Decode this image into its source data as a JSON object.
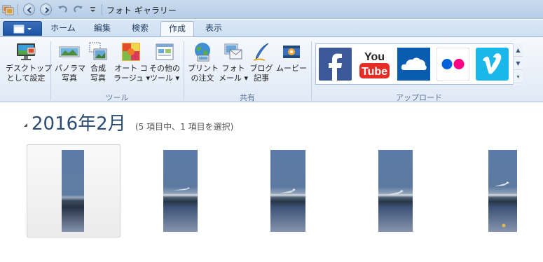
{
  "window": {
    "title": "フォト ギャラリー"
  },
  "tabs": [
    {
      "label": "ホーム",
      "active": false
    },
    {
      "label": "編集",
      "active": false
    },
    {
      "label": "検索",
      "active": false
    },
    {
      "label": "作成",
      "active": true
    },
    {
      "label": "表示",
      "active": false
    }
  ],
  "ribbon": {
    "desktop": {
      "line1": "デスクトップ",
      "line2": "として設定"
    },
    "tools": [
      {
        "line1": "パノラマ",
        "line2": "写真"
      },
      {
        "line1": "合成",
        "line2": "写真"
      },
      {
        "line1": "オート コ",
        "line2": "ラージュ ▾"
      },
      {
        "line1": "その他の",
        "line2": "ツール ▾"
      }
    ],
    "tools_group": "ツール",
    "share": [
      {
        "line1": "プリント",
        "line2": "の注文"
      },
      {
        "line1": "フォト",
        "line2": "メール ▾"
      },
      {
        "line1": "ブログ",
        "line2": "記事"
      },
      {
        "line1": "ムービー",
        "line2": ""
      }
    ],
    "share_group": "共有",
    "upload_group": "アップロード",
    "upload_services": [
      "facebook-icon",
      "youtube-icon",
      "onedrive-icon",
      "flickr-icon",
      "vimeo-icon"
    ]
  },
  "main": {
    "date_heading": "2016年2月",
    "count_text": "(5 項目中、1 項目を選択)"
  },
  "colors": {
    "accent": "#1d56a6",
    "facebook": "#3b5998",
    "youtube": "#e52d27",
    "onedrive": "#0a5cb0",
    "flickr_blue": "#0063dc",
    "flickr_pink": "#ff0084",
    "vimeo": "#1ab7ea"
  },
  "photos": [
    {
      "name": "photo-1",
      "selected": true
    },
    {
      "name": "photo-2",
      "selected": false
    },
    {
      "name": "photo-3",
      "selected": false
    },
    {
      "name": "photo-4",
      "selected": false
    },
    {
      "name": "photo-5",
      "selected": false
    }
  ]
}
